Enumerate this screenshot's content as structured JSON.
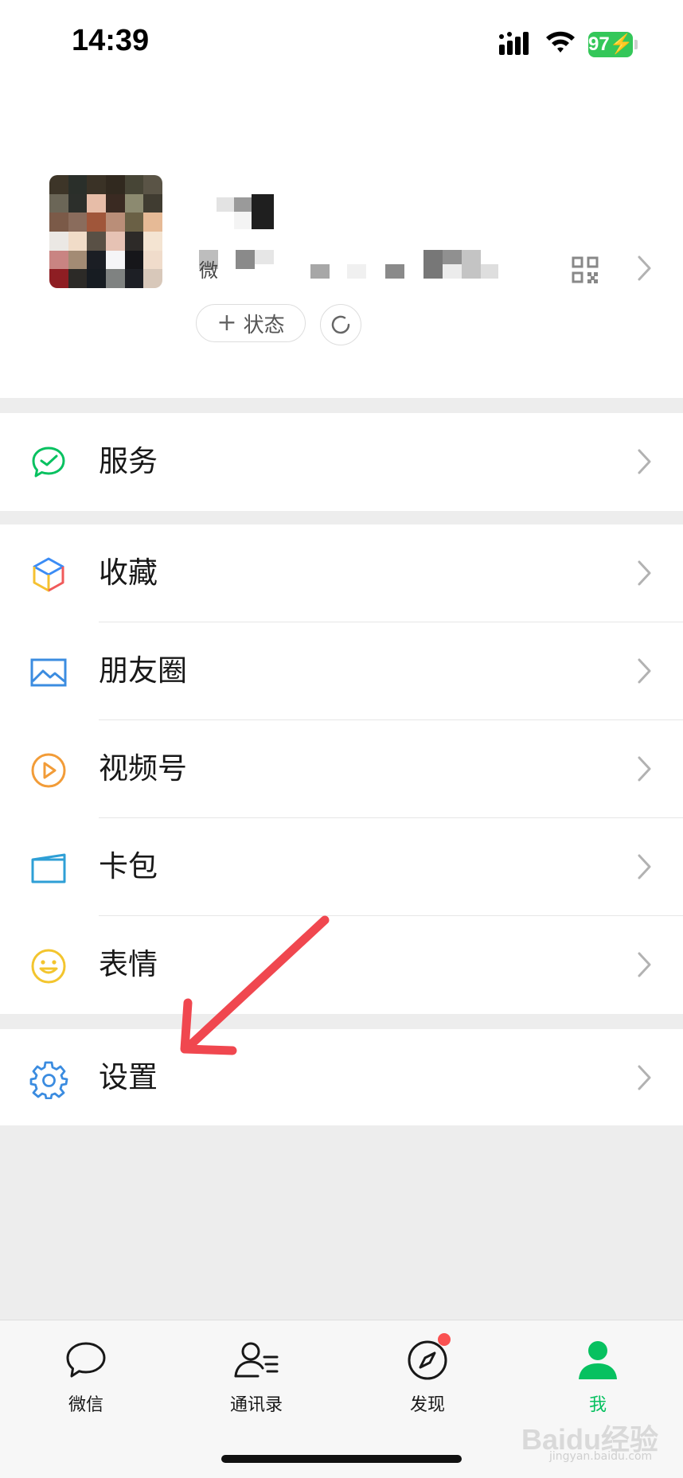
{
  "status_bar": {
    "time": "14:39",
    "battery": "97"
  },
  "profile": {
    "id_prefix": "微",
    "status_button": "状态",
    "status_plus": "+"
  },
  "menu": {
    "service": "服务",
    "favorites": "收藏",
    "moments": "朋友圈",
    "channels": "视频号",
    "cards": "卡包",
    "stickers": "表情",
    "settings": "设置"
  },
  "tabbar": {
    "chats": "微信",
    "contacts": "通讯录",
    "discover": "发现",
    "me": "我"
  },
  "watermark": {
    "brand": "Baidu经验",
    "url": "jingyan.baidu.com"
  },
  "colors": {
    "accent": "#07c160",
    "annotation_arrow": "#f0474f",
    "badge": "#fa5151"
  }
}
